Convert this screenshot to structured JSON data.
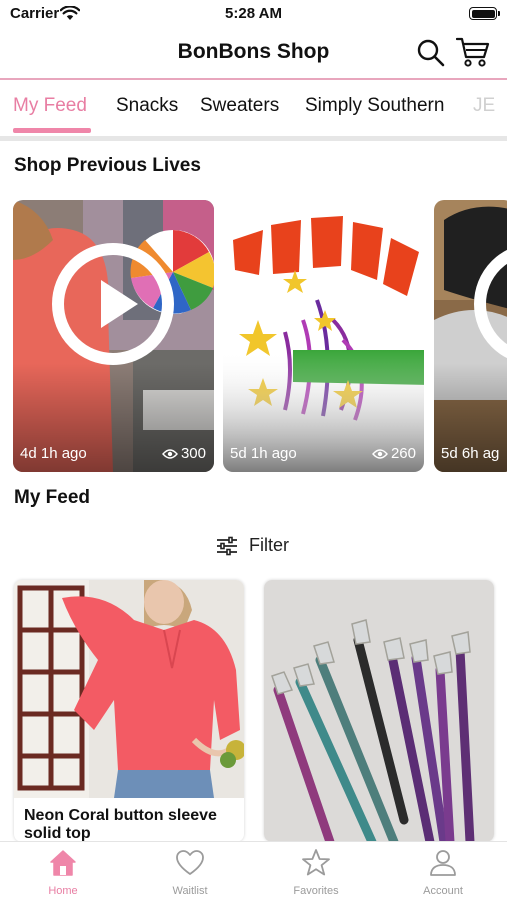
{
  "status_bar": {
    "carrier": "Carrier",
    "time": "5:28 AM"
  },
  "nav": {
    "title": "BonBons Shop",
    "search_icon": "search-icon",
    "cart_icon": "cart-icon"
  },
  "tabs": [
    {
      "label": "My Feed",
      "active": true
    },
    {
      "label": "Snacks"
    },
    {
      "label": "Sweaters"
    },
    {
      "label": "Simply Southern"
    },
    {
      "label": "JE"
    }
  ],
  "sections": {
    "previous_lives": "Shop Previous Lives",
    "my_feed": "My Feed"
  },
  "lives": [
    {
      "ago": "4d 1h ago",
      "views": "300"
    },
    {
      "ago": "5d 1h ago",
      "views": "260"
    },
    {
      "ago": "5d 6h ag"
    }
  ],
  "filter": {
    "label": "Filter"
  },
  "products": [
    {
      "name": "Neon Coral button sleeve solid top"
    },
    {
      "name": ""
    }
  ],
  "tab_bar": [
    {
      "label": "Home",
      "icon": "home-icon",
      "active": true
    },
    {
      "label": "Waitlist",
      "icon": "heart-icon"
    },
    {
      "label": "Favorites",
      "icon": "star-icon"
    },
    {
      "label": "Account",
      "icon": "person-icon"
    }
  ],
  "colors": {
    "accent": "#ef86a9",
    "accent_text": "#e87ea3",
    "divider": "#e8a6bd"
  }
}
